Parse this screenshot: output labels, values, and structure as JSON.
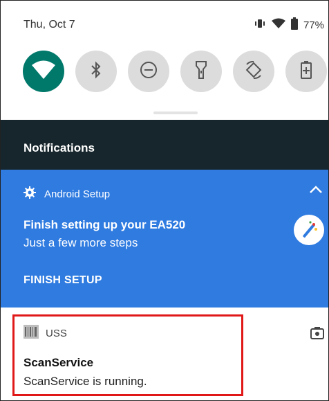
{
  "status_bar": {
    "date": "Thu, Oct 7",
    "battery_percent": "77%",
    "icons": [
      "vibrate-icon",
      "wifi-signal-icon",
      "battery-icon"
    ]
  },
  "quick_settings": {
    "tiles": [
      {
        "name": "wifi",
        "icon": "wifi-icon",
        "active": true
      },
      {
        "name": "bluetooth",
        "icon": "bluetooth-icon",
        "active": false
      },
      {
        "name": "do-not-disturb",
        "icon": "do-not-disturb-icon",
        "active": false
      },
      {
        "name": "flashlight",
        "icon": "flashlight-icon",
        "active": false
      },
      {
        "name": "auto-rotate",
        "icon": "rotate-icon",
        "active": false
      },
      {
        "name": "battery-saver",
        "icon": "battery-saver-icon",
        "active": false
      }
    ],
    "active_color": "#00796b"
  },
  "notifications": {
    "header_title": "Notifications",
    "items": [
      {
        "app_name": "Android Setup",
        "title": "Finish setting up your EA520",
        "text": "Just a few more steps",
        "action": "FINISH SETUP",
        "background": "#2f7be0"
      },
      {
        "app_name": "USS",
        "title": "ScanService",
        "text": "ScanService is running.",
        "highlight_color": "#e01818"
      }
    ]
  }
}
